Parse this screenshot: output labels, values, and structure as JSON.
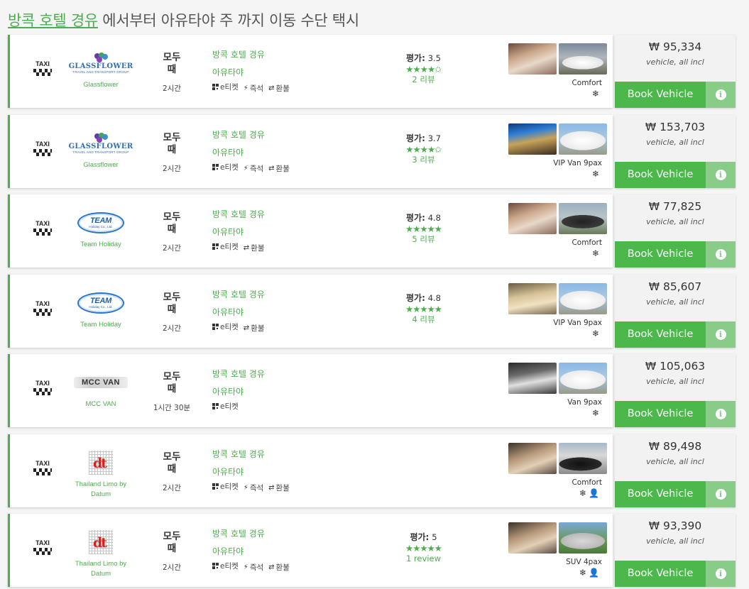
{
  "header": {
    "title_link": "방콕 호텔 경유",
    "title_rest": " 에서부터 아유타야 주 까지 이동 수단 택시"
  },
  "colors": {
    "accent": "#4cae4c",
    "button": "#4cb84c",
    "info_button": "#88cc88",
    "star": "#4cae4c"
  },
  "icons": {
    "transport": "taxi-icon",
    "eticket": "qr-code-icon",
    "instant": "lightning-icon",
    "refund": "exchange-arrows-icon",
    "aircon": "snowflake-icon",
    "driver": "driver-icon",
    "info": "info-icon"
  },
  "listings": [
    {
      "transport_label": "TAXI",
      "logo_type": "glassflower",
      "logo_text": "GLASSFLOWER",
      "logo_sub": "TRAVEL AND TRANSPORT GROUP",
      "company": "Glassflower",
      "when": "모두\n때",
      "duration": "2시간",
      "from": "방콕 호텔 경유",
      "to": "아유타야",
      "features": [
        "e티켓",
        "즉석",
        "환불"
      ],
      "rating_label": "평가:",
      "rating": "3.5",
      "stars": "★★★★✩",
      "reviews": "2 리뷰",
      "vehicle": "Comfort",
      "amenities": [
        "❄"
      ],
      "price": "₩ 95,334",
      "price_note": "vehicle, all incl",
      "book_label": "Book Vehicle",
      "info_label": "i",
      "photo_a": "car-interior",
      "photo_b": "white-sedan"
    },
    {
      "transport_label": "TAXI",
      "logo_type": "glassflower",
      "logo_text": "GLASSFLOWER",
      "logo_sub": "TRAVEL AND TRANSPORT GROUP",
      "company": "Glassflower",
      "when": "모두\n때",
      "duration": "2시간",
      "from": "방콕 호텔 경유",
      "to": "아유타야",
      "features": [
        "e티켓",
        "즉석",
        "환불"
      ],
      "rating_label": "평가:",
      "rating": "3.7",
      "stars": "★★★★✩",
      "reviews": "3 리뷰",
      "vehicle": "VIP Van 9pax",
      "amenities": [
        "❄"
      ],
      "price": "₩ 153,703",
      "price_note": "vehicle, all incl",
      "book_label": "Book Vehicle",
      "info_label": "i",
      "photo_a": "van-interior-blue",
      "photo_b": "white-van"
    },
    {
      "transport_label": "TAXI",
      "logo_type": "team",
      "logo_text": "TEAM",
      "logo_sub": "Holiday Co., Ltd.",
      "company": "Team Holiday",
      "when": "모두\n때",
      "duration": "2시간",
      "from": "방콕 호텔 경유",
      "to": "아유타야",
      "features": [
        "e티켓",
        "환불"
      ],
      "rating_label": "평가:",
      "rating": "4.8",
      "stars": "★★★★★",
      "reviews": "5 리뷰",
      "vehicle": "Comfort",
      "amenities": [
        "❄"
      ],
      "price": "₩ 77,825",
      "price_note": "vehicle, all incl",
      "book_label": "Book Vehicle",
      "info_label": "i",
      "photo_a": "car-interior",
      "photo_b": "dark-sedan"
    },
    {
      "transport_label": "TAXI",
      "logo_type": "team",
      "logo_text": "TEAM",
      "logo_sub": "Holiday Co., Ltd.",
      "company": "Team Holiday",
      "when": "모두\n때",
      "duration": "2시간",
      "from": "방콕 호텔 경유",
      "to": "아유타야",
      "features": [
        "e티켓",
        "환불"
      ],
      "rating_label": "평가:",
      "rating": "4.8",
      "stars": "★★★★★",
      "reviews": "4 리뷰",
      "vehicle": "VIP Van 9pax",
      "amenities": [
        "❄"
      ],
      "price": "₩ 85,607",
      "price_note": "vehicle, all incl",
      "book_label": "Book Vehicle",
      "info_label": "i",
      "photo_a": "van-interior-beige",
      "photo_b": "white-van"
    },
    {
      "transport_label": "TAXI",
      "logo_type": "mcc",
      "logo_text": "MCC VAN",
      "logo_sub": "",
      "company": "MCC VAN",
      "when": "모두\n때",
      "duration": "1시간 30분",
      "from": "방콕 호텔 경유",
      "to": "아유타야",
      "features": [
        "e티켓"
      ],
      "rating_label": "",
      "rating": "",
      "stars": "",
      "reviews": "",
      "vehicle": "Van 9pax",
      "amenities": [
        "❄"
      ],
      "price": "₩ 105,063",
      "price_note": "vehicle, all incl",
      "book_label": "Book Vehicle",
      "info_label": "i",
      "photo_a": "van-interior-grey",
      "photo_b": "white-van"
    },
    {
      "transport_label": "TAXI",
      "logo_type": "dt",
      "logo_text": "dt",
      "logo_sub": "",
      "company": "Thailand Limo by Datum",
      "when": "모두\n때",
      "duration": "2시간",
      "from": "방콕 호텔 경유",
      "to": "아유타야",
      "features": [
        "e티켓",
        "즉석",
        "환불"
      ],
      "rating_label": "",
      "rating": "",
      "stars": "",
      "reviews": "",
      "vehicle": "Comfort",
      "amenities": [
        "❄",
        "👤"
      ],
      "price": "₩ 89,498",
      "price_note": "vehicle, all incl",
      "book_label": "Book Vehicle",
      "info_label": "i",
      "photo_a": "car-interior-beige",
      "photo_b": "black-sedan-ship"
    },
    {
      "transport_label": "TAXI",
      "logo_type": "dt",
      "logo_text": "dt",
      "logo_sub": "",
      "company": "Thailand Limo by Datum",
      "when": "모두\n때",
      "duration": "2시간",
      "from": "방콕 호텔 경유",
      "to": "아유타야",
      "features": [
        "e티켓",
        "즉석",
        "환불"
      ],
      "rating_label": "평가:",
      "rating": "5",
      "stars": "★★★★★",
      "reviews": "1 review",
      "vehicle": "SUV 4pax",
      "amenities": [
        "❄",
        "👤"
      ],
      "price": "₩ 93,390",
      "price_note": "vehicle, all incl",
      "book_label": "Book Vehicle",
      "info_label": "i",
      "photo_a": "car-interior-beige",
      "photo_b": "silver-suv"
    }
  ]
}
